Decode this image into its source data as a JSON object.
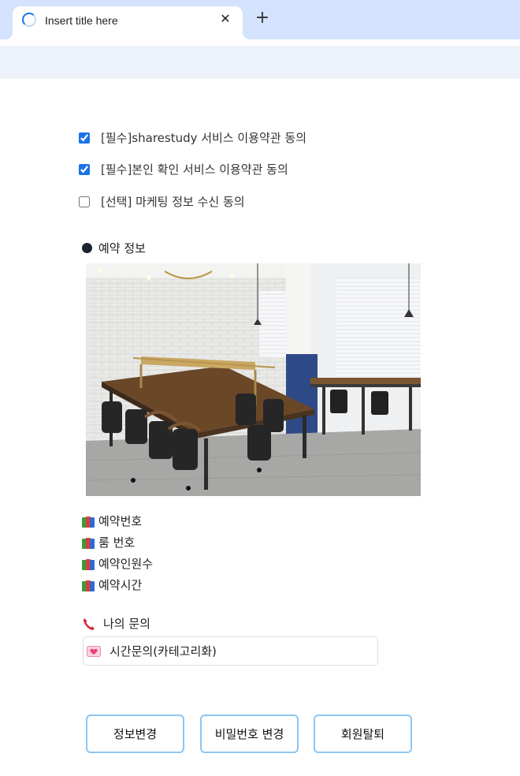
{
  "browser": {
    "tab_title": "Insert title here",
    "close_symbol": "✕",
    "new_tab_symbol": "+"
  },
  "agreements": [
    {
      "label": "[필수]sharestudy 서비스 이용약관 동의",
      "checked": true
    },
    {
      "label": "[필수]본인 확인 서비스 이용약관 동의",
      "checked": true
    },
    {
      "label": "[선택] 마케팅 정보 수신 동의",
      "checked": false
    }
  ],
  "reservation": {
    "title": "예약 정보",
    "photo_icon": "study-room-photo",
    "items": [
      {
        "icon": "books-icon",
        "label": "예약번호"
      },
      {
        "icon": "books-icon",
        "label": "룸 번호"
      },
      {
        "icon": "books-icon",
        "label": "예약인원수"
      },
      {
        "icon": "books-icon",
        "label": "예약시간"
      }
    ]
  },
  "inquiry": {
    "title": "나의 문의",
    "icon": "telephone-icon",
    "item_icon": "heart-icon",
    "item_text": "시간문의(카테고리화)"
  },
  "buttons": {
    "edit_info": "정보변경",
    "change_password": "비밀번호 변경",
    "withdraw": "회원탈퇴"
  },
  "colors": {
    "tabstrip": "#d3e3fd",
    "toolbar": "#edf2fa",
    "button_border": "#8cc6f2",
    "checkbox_accent": "#1a73e8"
  }
}
